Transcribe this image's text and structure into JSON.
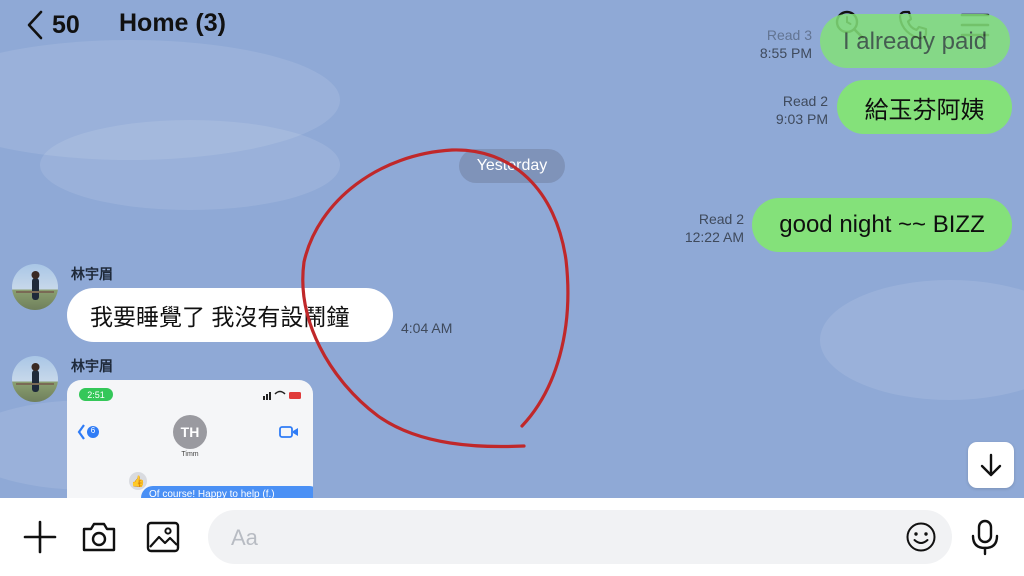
{
  "header": {
    "back_count": "50",
    "title": "Home (3)"
  },
  "messages_out": [
    {
      "read": "Read 3",
      "time": "8:55 PM",
      "text": "I already paid"
    },
    {
      "read": "Read 2",
      "time": "9:03 PM",
      "text": "給玉芬阿姨"
    },
    {
      "read": "Read 2",
      "time": "12:22 AM",
      "text": "good night ~~ BIZZ"
    }
  ],
  "date_divider": "Yesterday",
  "messages_in": [
    {
      "sender": "林宇眉",
      "text": "我要睡覺了 我沒有設鬧鐘",
      "time": "4:04 AM"
    },
    {
      "sender": "林宇眉"
    }
  ],
  "screenshot_preview": {
    "status_time": "2:51",
    "back_badge": "6",
    "avatar_initials": "TH",
    "contact_name": "Timm",
    "message_snippet": "Of course! Happy to help (f.)"
  },
  "input": {
    "placeholder": "Aa"
  },
  "colors": {
    "chat_background": "#8fa9d6",
    "outgoing_bubble": "#84e17a",
    "annotation_circle": "#c0282a"
  },
  "icons": [
    "chevron-left-icon",
    "search-icon",
    "phone-icon",
    "menu-icon",
    "arrow-down-icon",
    "plus-icon",
    "camera-icon",
    "image-icon",
    "emoji-icon",
    "microphone-icon"
  ]
}
